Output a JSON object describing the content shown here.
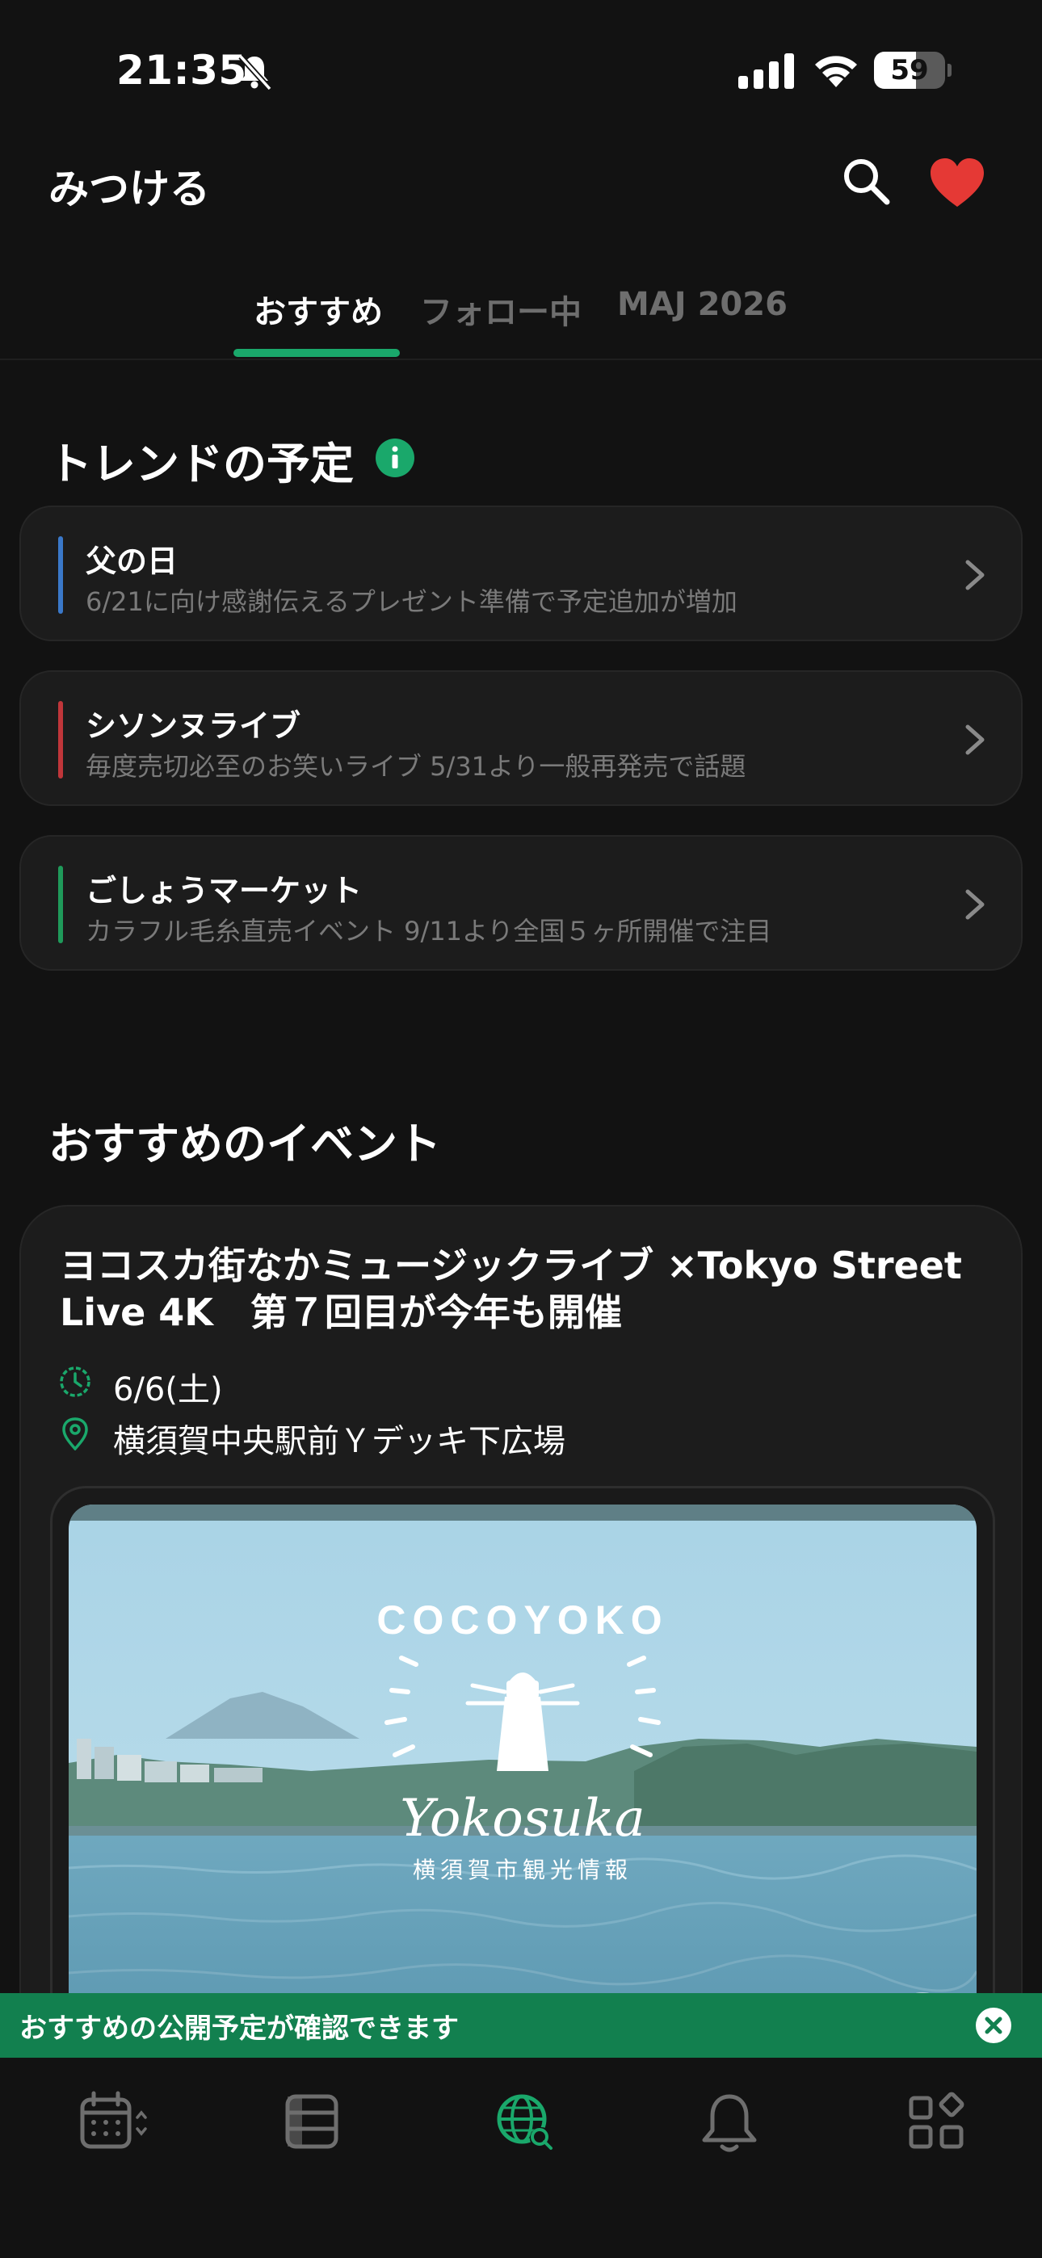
{
  "status_bar": {
    "time": "21:35",
    "battery": "59",
    "battery_level": 0.59
  },
  "header": {
    "title": "みつける"
  },
  "tabs": [
    {
      "label": "おすすめ",
      "active": true
    },
    {
      "label": "フォロー中",
      "active": false
    },
    {
      "label": "MAJ 2026",
      "active": false
    }
  ],
  "trends": {
    "title": "トレンドの予定",
    "items": [
      {
        "title": "父の日",
        "description": "6/21に向け感謝伝えるプレゼント準備で予定追加が増加",
        "accent": "#3a78c9"
      },
      {
        "title": "シソンヌライブ",
        "description": "毎度売切必至のお笑いライブ 5/31より一般再発売で話題",
        "accent": "#c0363a"
      },
      {
        "title": "ごしょうマーケット",
        "description": "カラフル毛糸直売イベント 9/11より全国５ヶ所開催で注目",
        "accent": "#1f9a5a"
      }
    ]
  },
  "events": {
    "title": "おすすめのイベント",
    "card": {
      "title": "ヨコスカ街なかミュージックライブ ×Tokyo Street Live 4K　第７回目が今年も開催",
      "date": "6/6(土)",
      "place": "横須賀中央駅前Ｙデッキ下広場",
      "image": {
        "logo_top": "COCOYOKO",
        "logo_script": "Yokosuka",
        "logo_caption": "横須賀市観光情報"
      }
    }
  },
  "toast": {
    "text": "おすすめの公開予定が確認できます"
  },
  "tab_bar": {
    "items": [
      {
        "icon": "calendar-icon",
        "active": false
      },
      {
        "icon": "list-icon",
        "active": false
      },
      {
        "icon": "globe-search-icon",
        "active": true
      },
      {
        "icon": "bell-icon",
        "active": false
      },
      {
        "icon": "apps-icon",
        "active": false
      }
    ]
  },
  "colors": {
    "accent": "#1aa86b",
    "heart": "#e53935",
    "toast": "#12804f"
  }
}
